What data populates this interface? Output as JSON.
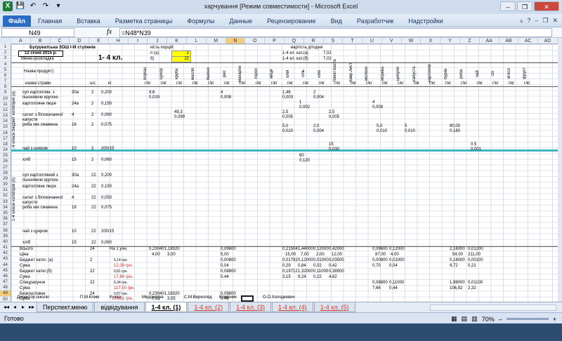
{
  "window": {
    "title": "харчування  [Режим совместимости]  -  Microsoft Excel",
    "buttons": [
      "–",
      "❐",
      "✕"
    ]
  },
  "ribbon": {
    "file_tab": "Файл",
    "tabs": [
      "Главная",
      "Вставка",
      "Разметка страницы",
      "Формулы",
      "Данные",
      "Рецензирование",
      "Вид",
      "Разработчик",
      "Надстройки"
    ]
  },
  "formula_bar": {
    "name_box": "N49",
    "fx": "fx",
    "formula": "=N48*N39"
  },
  "columns": [
    "A",
    "B",
    "C",
    "D",
    "E",
    "H",
    "I",
    "J",
    "K",
    "L",
    "M",
    "N",
    "O",
    "P",
    "Q",
    "R",
    "S",
    "T",
    "U",
    "V",
    "W",
    "X",
    "Y",
    "Z",
    "AA",
    "AB",
    "AC",
    "AD"
  ],
  "rows": [
    "1",
    "2",
    "3",
    "4",
    "5",
    "6",
    "7",
    "8",
    "9",
    "10",
    "11",
    "12",
    "13",
    "14",
    "15",
    "16",
    "17",
    "18",
    "24",
    "25",
    "26",
    "27",
    "28",
    "29",
    "30",
    "31",
    "32",
    "33",
    "34",
    "35",
    "36",
    "37",
    "38",
    "39",
    "40",
    "41",
    "42",
    "43",
    "44",
    "45",
    "46",
    "47",
    "48",
    "49",
    "50",
    "51",
    "52",
    "53"
  ],
  "sheet": {
    "school": "Бугруватська ЗОШ І-ІІІ ступенів",
    "date": "12 січня 2015 р.",
    "menu_label": "Меню-розкладка",
    "class_label": "1- 4 кл.",
    "portions_label": "кість порцій:",
    "cat_a_label": "п (а)",
    "cat_b_label": "б)",
    "portions_a": "2",
    "portions_b": "22",
    "cost_label": "вартість дітодня",
    "cost_a_label": "1-4 кл. кат.(а)",
    "cost_a": "7,02",
    "cost_b_label": "1-4 кл. кат.(б)",
    "cost_b": "7,02",
    "dish_header": "Назва продукт)",
    "dish_name_header": "назва страви",
    "units": [
      "шт.",
      "кг",
      "г/кг"
    ],
    "cat_a_side": "1-4 класи бюджет   категорія (а)",
    "cat_b_side": "1-4 класи категорія (б)",
    "dishes_a": [
      {
        "name": "суп картоплян. з пшоняною крупою",
        "rec": "30а",
        "n": "2",
        "w": "0,200"
      },
      {
        "name": "картопляне пюре",
        "rec": "24а",
        "n": "2",
        "w": "0,150"
      },
      {
        "name": "салат з білокачанної капусти",
        "rec": "4",
        "n": "2",
        "w": "0,060"
      },
      {
        "name": "риба хек смажена",
        "rec": "18",
        "n": "2",
        "w": "0,075"
      },
      {
        "name": "чай з цукром",
        "rec": "10",
        "n": "2",
        "w": "200/15"
      },
      {
        "name": "хліб",
        "rec": "15",
        "n": "2",
        "w": "0,060"
      }
    ],
    "dishes_b": [
      {
        "name": "суп картопляний з пшоняною крупою",
        "rec": "30а",
        "n": "22",
        "w": "0,200"
      },
      {
        "name": "картопляне пюре",
        "rec": "24а",
        "n": "22",
        "w": "0,150"
      },
      {
        "name": "салат з білокачанної капусти",
        "rec": "4",
        "n": "22",
        "w": "0,050"
      },
      {
        "name": "риба хек смажена",
        "rec": "18",
        "n": "22",
        "w": "0,075"
      },
      {
        "name": "чай з цукром",
        "rec": "10",
        "n": "22",
        "w": "200/15"
      },
      {
        "name": "хліб",
        "rec": "15",
        "n": "22",
        "w": "0,060"
      }
    ],
    "products": [
      "борош",
      "цукор",
      "крупа",
      "масло",
      "пшоно",
      "рис",
      "макарон",
      "горох",
      "яйця",
      "олія",
      "сіль",
      "хліб",
      "томат.паста",
      "лавр.лист",
      "молоко",
      "морква",
      "цибуля",
      "капуста",
      "картопля",
      "буряк",
      "риба",
      "чай",
      "сік",
      "м'ясо",
      "фрукт"
    ],
    "vals_a": [
      {
        "row": "9,6",
        "v": "0,019"
      },
      {
        "row": "4",
        "v": "0,008"
      },
      {
        "row": "1,46",
        "v": "0,003"
      },
      {
        "row": "2",
        "v": "0,004"
      },
      {
        "row": "49,3",
        "v": "0,099"
      },
      {
        "row": "1",
        "v": "0,002"
      },
      {
        "row": "4",
        "v": "0,008"
      },
      {
        "row": "2,5",
        "v": "0,005"
      },
      {
        "row": "2,5",
        "v": "0,005"
      },
      {
        "row": "5,0",
        "v": "0,010"
      },
      {
        "row": "2,0",
        "v": "0,004"
      },
      {
        "row": "5,0",
        "v": "0,010"
      },
      {
        "row": "5",
        "v": "0,010"
      },
      {
        "row": "90,00",
        "v": "0,180"
      },
      {
        "row": "15",
        "v": "0,030"
      },
      {
        "row": "0,5",
        "v": "0,001"
      },
      {
        "row": "60",
        "v": "0,120"
      }
    ],
    "totals": {
      "vsogo_label": "Всього",
      "vsogo_n": "24",
      "vsogo_unit": "На 1 учн.",
      "tsina_label": "Ціна",
      "budget_a_label": "Бюджет     катег. (а)",
      "budget_a_n": "2",
      "budget_a_price": "6,14 грн.",
      "suma_label": "Сума",
      "suma_a": "12,29 грн.",
      "budget_b_label": "Бюджет    катег.(б)",
      "budget_b_n": "22",
      "budget_b_price": "0,81 грн.",
      "suma_b": "17,84 грн.",
      "spec_label": "Спецрахунок",
      "spec_n": "22",
      "spec_price": "6,34 грн.",
      "suma_spec": "117,50 грн.",
      "bezosh_label": "Безкоштовне",
      "bezosh_n": "24",
      "bezosh_price": "0,87 грн.",
      "suma_bez": "20,91 грн.",
      "row38": [
        "0,23040",
        "1,18320",
        "0,09600",
        "0,21504",
        "1,44000",
        "0,12000",
        "0,42000",
        "0,09600",
        "0,12000",
        "2,16000",
        "0,01200"
      ],
      "row39": [
        "4,00",
        "3,00",
        "5,00",
        "15,00",
        "7,00",
        "2,00",
        "12,00",
        "87,00",
        "4,00",
        "54,00",
        "211,00"
      ],
      "row40": [
        "0,00800",
        "0,01792",
        "0,12000",
        "0,01000",
        "0,03500",
        "0,00800",
        "0,01000",
        "0,18000",
        "0,00100"
      ],
      "row41": [
        "0,04",
        "0,29",
        "0,84",
        "0,02",
        "0,42",
        "0,70",
        "0,04",
        "9,72",
        "0,21"
      ],
      "row42": [
        "0,08800",
        "0,19712",
        "1,32000",
        "0,11000",
        "0,38500"
      ],
      "row43": [
        "0,44",
        "3,15",
        "9,24",
        "0,22",
        "4,62"
      ],
      "row44": [
        "0,08800",
        "0,11000",
        "1,98000",
        "0,01100"
      ],
      "row45": [
        "7,66",
        "0,44",
        "106,92",
        "2,32"
      ],
      "row48": [
        "0,23040",
        "1,18320",
        "0,09600"
      ],
      "row49": [
        "0,92",
        "3,55",
        "0,48"
      ]
    },
    "footer": {
      "director": "Директор школи:",
      "director_name": "П.М.Клим",
      "cook": "Кухар",
      "medsister": "Медсестра",
      "medsister_name": "С.М.Верхоляд",
      "storekeeper": "Комірник",
      "storekeeper_name": "О.О.Холодкевич"
    }
  },
  "sheet_tabs": {
    "nav": [
      "◂◂",
      "◂",
      "▸",
      "▸▸"
    ],
    "tabs": [
      "Перспект.меню",
      "відвідування",
      "1-4 кл.  (1)",
      "1-4 кл.  (2)",
      "1-4 кл.  (3)",
      "1-4 кл.  (4)",
      "1-4 кл.  (5)"
    ]
  },
  "status": {
    "ready": "Готово",
    "zoom": "70%"
  }
}
